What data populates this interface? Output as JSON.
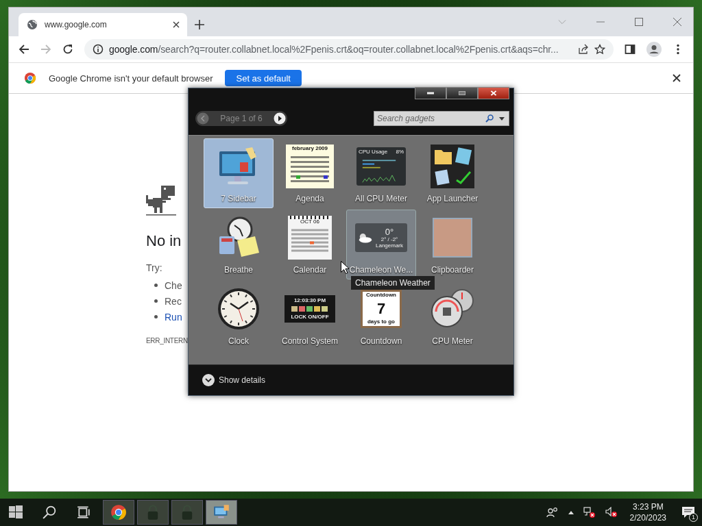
{
  "browser": {
    "tab": {
      "title": "www.google.com"
    },
    "address": {
      "host": "google.com",
      "path": "/search?q=router.collabnet.local%2Fpenis.crt&oq=router.collabnet.local%2Fpenis.crt&aqs=chr..."
    },
    "infobar": {
      "message": "Google Chrome isn't your default browser",
      "button": "Set as default"
    },
    "page": {
      "heading": "No in",
      "try_label": "Try:",
      "suggestions": [
        {
          "text": "Che",
          "link": false
        },
        {
          "text": "Rec",
          "link": false
        },
        {
          "text": "Run",
          "link": true
        }
      ],
      "error_code": "ERR_INTERN"
    }
  },
  "gadgets_window": {
    "page_label": "Page 1 of 6",
    "search": {
      "placeholder": "Search gadgets"
    },
    "gadgets": [
      {
        "label": "7 Sidebar",
        "kind": "sidebar",
        "selected": true,
        "hovered": false
      },
      {
        "label": "Agenda",
        "kind": "agenda",
        "selected": false,
        "hovered": false,
        "preview_texts": [
          "february 2009"
        ]
      },
      {
        "label": "All CPU Meter",
        "kind": "cpu-usage",
        "selected": false,
        "hovered": false,
        "preview_texts": [
          "CPU Usage",
          "8%"
        ]
      },
      {
        "label": "App Launcher",
        "kind": "launcher",
        "selected": false,
        "hovered": false
      },
      {
        "label": "Breathe",
        "kind": "breathe",
        "selected": false,
        "hovered": false
      },
      {
        "label": "Calendar",
        "kind": "calendar",
        "selected": false,
        "hovered": false,
        "preview_texts": [
          "OCT 06"
        ]
      },
      {
        "label": "Chameleon We...",
        "kind": "weather",
        "selected": false,
        "hovered": true,
        "preview_texts": [
          "0°",
          "2° / -2°",
          "Langemark"
        ]
      },
      {
        "label": "Clipboarder",
        "kind": "photo",
        "selected": false,
        "hovered": false
      },
      {
        "label": "Clock",
        "kind": "clock",
        "selected": false,
        "hovered": false
      },
      {
        "label": "Control System",
        "kind": "control",
        "selected": false,
        "hovered": false,
        "preview_texts": [
          "12:03:30 PM",
          "LOCK ON/OFF"
        ]
      },
      {
        "label": "Countdown",
        "kind": "countdown",
        "selected": false,
        "hovered": false,
        "preview_texts": [
          "Countdown",
          "7",
          "days to go"
        ]
      },
      {
        "label": "CPU Meter",
        "kind": "cpu-meter",
        "selected": false,
        "hovered": false
      }
    ],
    "tooltip": "Chameleon Weather",
    "details_label": "Show details"
  },
  "taskbar": {
    "apps": [
      {
        "kind": "chrome",
        "active": false
      },
      {
        "kind": "lock",
        "active": false
      },
      {
        "kind": "lock",
        "active": false
      },
      {
        "kind": "gadgets",
        "active": true
      }
    ],
    "time": "3:23 PM",
    "date": "2/20/2023",
    "notification_count": "1"
  }
}
